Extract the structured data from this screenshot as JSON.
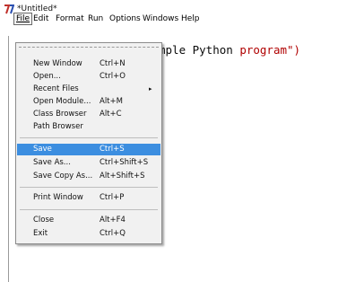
{
  "window": {
    "title": "*Untitled*",
    "icon": "idle-icon"
  },
  "menubar": {
    "items": [
      {
        "label": "File",
        "mnemonic": "F"
      },
      {
        "label": "Edit",
        "mnemonic": "E"
      },
      {
        "label": "Format",
        "mnemonic": "o"
      },
      {
        "label": "Run",
        "mnemonic": "R"
      },
      {
        "label": "Options",
        "mnemonic": "O"
      },
      {
        "label": "Windows",
        "mnemonic": "W"
      },
      {
        "label": "Help",
        "mnemonic": "H"
      }
    ],
    "open_menu": "File"
  },
  "editor": {
    "visible_text_plain": "mple Python ",
    "visible_text_string": "program\")"
  },
  "file_menu": {
    "items": [
      {
        "label": "New Window",
        "accel": "Ctrl+N"
      },
      {
        "label": "Open...",
        "accel": "Ctrl+O"
      },
      {
        "label": "Recent Files",
        "accel": "",
        "submenu": true
      },
      {
        "label": "Open Module...",
        "accel": "Alt+M"
      },
      {
        "label": "Class Browser",
        "accel": "Alt+C"
      },
      {
        "label": "Path Browser",
        "accel": ""
      },
      {
        "label": "Save",
        "accel": "Ctrl+S",
        "selected": true
      },
      {
        "label": "Save As...",
        "accel": "Ctrl+Shift+S"
      },
      {
        "label": "Save Copy As...",
        "accel": "Alt+Shift+S"
      },
      {
        "label": "Print Window",
        "accel": "Ctrl+P"
      },
      {
        "label": "Close",
        "accel": "Alt+F4"
      },
      {
        "label": "Exit",
        "accel": "Ctrl+Q"
      }
    ],
    "submenu_arrow": "▸"
  },
  "colors": {
    "selection": "#3c8ee0",
    "string": "#b00000",
    "menu_bg": "#f1f1f1"
  }
}
